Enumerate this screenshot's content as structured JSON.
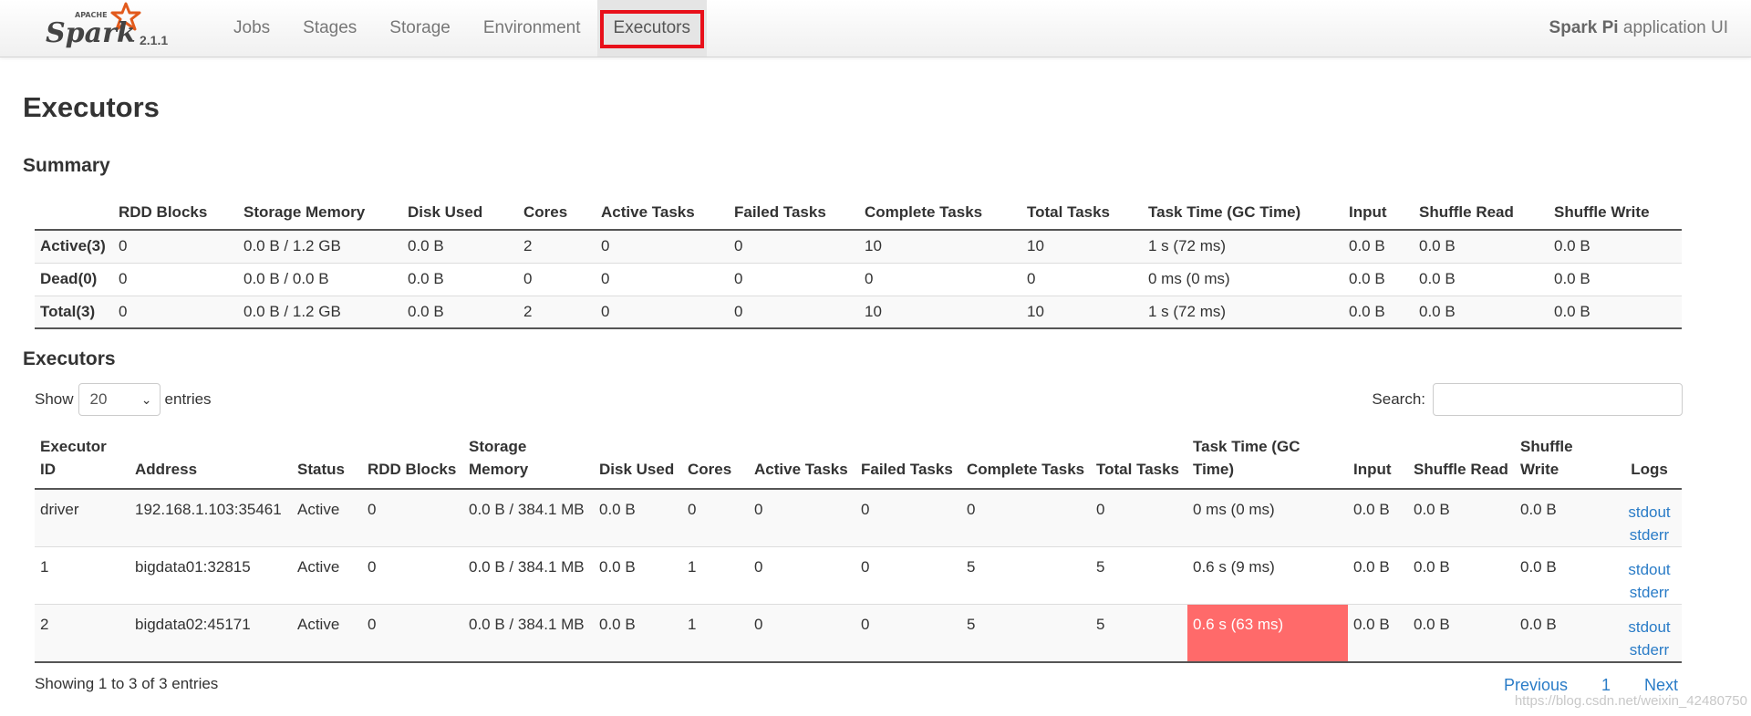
{
  "navbar": {
    "brand_apache": "APACHE",
    "brand_name": "Spark",
    "version": "2.1.1",
    "tabs": [
      {
        "label": "Jobs"
      },
      {
        "label": "Stages"
      },
      {
        "label": "Storage"
      },
      {
        "label": "Environment"
      },
      {
        "label": "Executors",
        "active": true
      }
    ],
    "app_name": "Spark Pi",
    "app_suffix": " application UI"
  },
  "page": {
    "title": "Executors",
    "summary_title": "Summary",
    "executors_title": "Executors"
  },
  "summary": {
    "headers": [
      "",
      "RDD Blocks",
      "Storage Memory",
      "Disk Used",
      "Cores",
      "Active Tasks",
      "Failed Tasks",
      "Complete Tasks",
      "Total Tasks",
      "Task Time (GC Time)",
      "Input",
      "Shuffle Read",
      "Shuffle Write"
    ],
    "rows": [
      [
        "Active(3)",
        "0",
        "0.0 B / 1.2 GB",
        "0.0 B",
        "2",
        "0",
        "0",
        "10",
        "10",
        "1 s (72 ms)",
        "0.0 B",
        "0.0 B",
        "0.0 B"
      ],
      [
        "Dead(0)",
        "0",
        "0.0 B / 0.0 B",
        "0.0 B",
        "0",
        "0",
        "0",
        "0",
        "0",
        "0 ms (0 ms)",
        "0.0 B",
        "0.0 B",
        "0.0 B"
      ],
      [
        "Total(3)",
        "0",
        "0.0 B / 1.2 GB",
        "0.0 B",
        "2",
        "0",
        "0",
        "10",
        "10",
        "1 s (72 ms)",
        "0.0 B",
        "0.0 B",
        "0.0 B"
      ]
    ]
  },
  "controls": {
    "show_label": "Show",
    "page_size": "20",
    "entries_label": "entries",
    "search_label": "Search:",
    "search_value": ""
  },
  "executors": {
    "headers": [
      "Executor ID",
      "Address",
      "Status",
      "RDD Blocks",
      "Storage Memory",
      "Disk Used",
      "Cores",
      "Active Tasks",
      "Failed Tasks",
      "Complete Tasks",
      "Total Tasks",
      "Task Time (GC Time)",
      "Input",
      "Shuffle Read",
      "Shuffle Write",
      "Logs"
    ],
    "rows": [
      {
        "cells": [
          "driver",
          "192.168.1.103:35461",
          "Active",
          "0",
          "0.0 B / 384.1 MB",
          "0.0 B",
          "0",
          "0",
          "0",
          "0",
          "0",
          "0 ms (0 ms)",
          "0.0 B",
          "0.0 B",
          "0.0 B"
        ],
        "stdout": "stdout",
        "stderr": "stderr"
      },
      {
        "cells": [
          "1",
          "bigdata01:32815",
          "Active",
          "0",
          "0.0 B / 384.1 MB",
          "0.0 B",
          "1",
          "0",
          "0",
          "5",
          "5",
          "0.6 s (9 ms)",
          "0.0 B",
          "0.0 B",
          "0.0 B"
        ],
        "stdout": "stdout",
        "stderr": "stderr"
      },
      {
        "cells": [
          "2",
          "bigdata02:45171",
          "Active",
          "0",
          "0.0 B / 384.1 MB",
          "0.0 B",
          "1",
          "0",
          "0",
          "5",
          "5",
          "0.6 s (63 ms)",
          "0.0 B",
          "0.0 B",
          "0.0 B"
        ],
        "stdout": "stdout",
        "stderr": "stderr"
      }
    ],
    "gc_highlight_color": "#ff6a6a"
  },
  "footer": {
    "info": "Showing 1 to 3 of 3 entries",
    "previous": "Previous",
    "page": "1",
    "next": "Next"
  },
  "watermark": "https://blog.csdn.net/weixin_42480750",
  "colors": {
    "link": "#2a7cc7",
    "highlight_box": "#e8101a",
    "spark_orange": "#e25a1c"
  }
}
